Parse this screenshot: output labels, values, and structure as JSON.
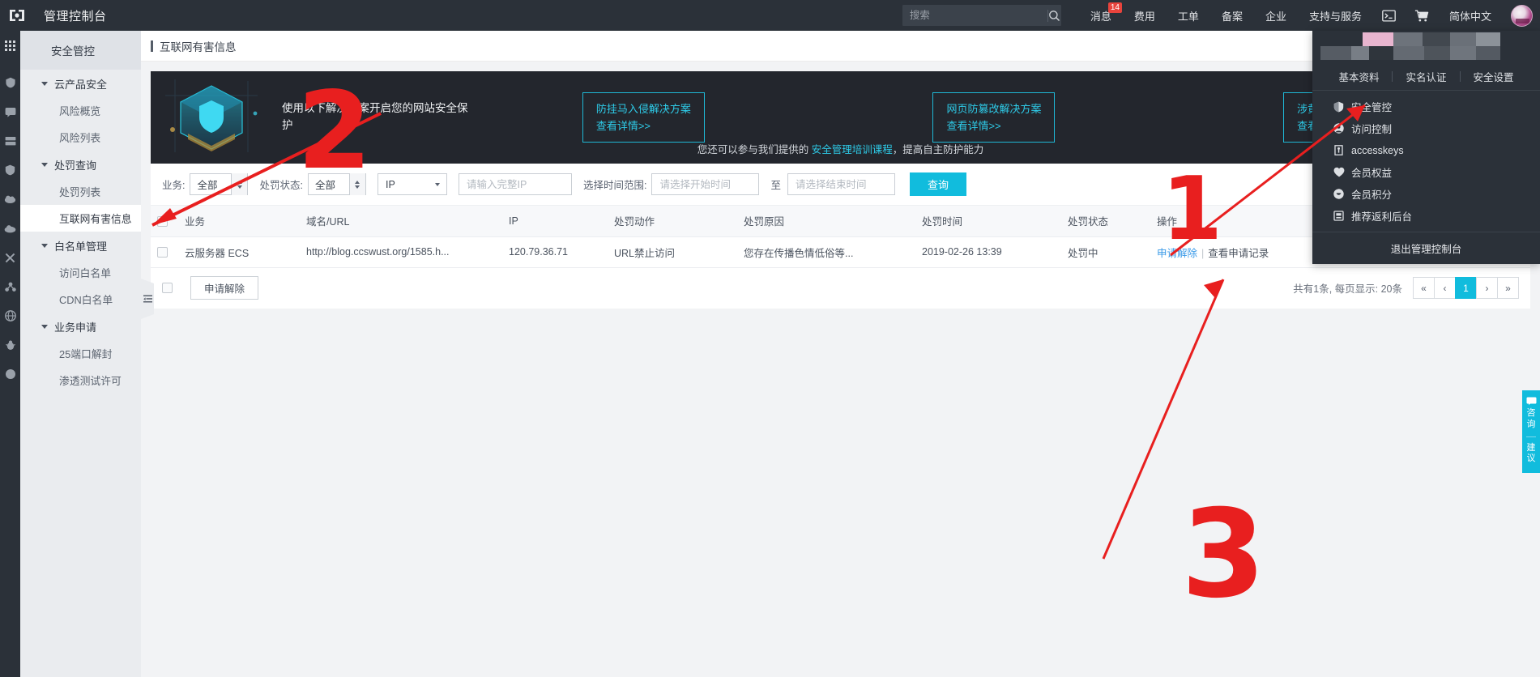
{
  "topbar": {
    "logo_icon": "cloud-bracket-logo-icon",
    "title": "管理控制台",
    "search": {
      "placeholder": "搜索",
      "value": "",
      "icon": "search-icon"
    },
    "nav": [
      {
        "label": "消息",
        "badge": "14"
      },
      {
        "label": "费用",
        "badge": ""
      },
      {
        "label": "工单",
        "badge": ""
      },
      {
        "label": "备案",
        "badge": ""
      },
      {
        "label": "企业",
        "badge": ""
      },
      {
        "label": "支持与服务",
        "badge": ""
      }
    ],
    "terminal_icon": "terminal-icon",
    "cart_icon": "shopping-cart-icon",
    "language": "简体中文",
    "avatar_icon": "user-avatar"
  },
  "rail": {
    "items": [
      "grid-apps-icon",
      "cloud-shield-icon",
      "chat-bubble-icon",
      "server-stack-icon",
      "shield-icon",
      "cloud-network-icon",
      "cloud-storage-icon",
      "scissors-icon",
      "users-group-icon",
      "globe-icon",
      "bug-icon",
      "circle-dot-icon"
    ]
  },
  "sidebar": {
    "header": "安全管控",
    "groups": [
      {
        "label": "云产品安全",
        "items": [
          "风险概览",
          "风险列表"
        ]
      },
      {
        "label": "处罚查询",
        "items": [
          "处罚列表",
          "互联网有害信息"
        ]
      },
      {
        "label": "白名单管理",
        "items": [
          "访问白名单",
          "CDN白名单"
        ]
      },
      {
        "label": "业务申请",
        "items": [
          "25端口解封",
          "渗透测试许可"
        ]
      }
    ],
    "active_item": "互联网有害信息",
    "collapse_icon": "collapse-sidebar-icon"
  },
  "page": {
    "title": "互联网有害信息"
  },
  "banner": {
    "art_icon": "security-cube-shield-illustration",
    "headline": "使用以下解决方案开启您的网站安全保护",
    "solutions": [
      {
        "title": "防挂马入侵解决方案",
        "link": "查看详情>>"
      },
      {
        "title": "网页防篡改解决方案",
        "link": "查看详情>>"
      },
      {
        "title": "涉黄涉政检测解决方案",
        "link": "查看详情>>"
      }
    ],
    "note_prefix": "您还可以参与我们提供的 ",
    "note_link": "安全管理培训课程",
    "note_suffix": "，提高自主防护能力"
  },
  "filters": {
    "business_label": "业务:",
    "business_value": "全部",
    "status_label": "处罚状态:",
    "status_value": "全部",
    "type_value": "IP",
    "ip_placeholder": "请输入完整IP",
    "ip_value": "",
    "date_label": "选择时间范围:",
    "start_placeholder": "请选择开始时间",
    "start_value": "",
    "at_label": "至",
    "end_placeholder": "请选择结束时间",
    "end_value": "",
    "query_button": "查询"
  },
  "table": {
    "columns": [
      "业务",
      "域名/URL",
      "IP",
      "处罚动作",
      "处罚原因",
      "处罚时间",
      "处罚状态",
      "操作"
    ],
    "rows": [
      {
        "business": "云服务器 ECS",
        "url": "http://blog.ccswust.org/1585.h...",
        "ip": "120.79.36.71",
        "action": "URL禁止访问",
        "reason": "您存在传播色情低俗等...",
        "time": "2019-02-26 13:39",
        "status": "处罚中",
        "op_primary": "申请解除",
        "op_separator": "|",
        "op_secondary": "查看申请记录"
      }
    ]
  },
  "footer": {
    "release_button": "申请解除",
    "summary": "共有1条, 每页显示: 20条",
    "pages": [
      "«",
      "‹",
      "1",
      "›",
      "»"
    ],
    "current_page": "1"
  },
  "user_panel": {
    "tabs": [
      "基本资料",
      "实名认证",
      "安全设置"
    ],
    "items": [
      {
        "label": "安全管控",
        "icon": "shield-icon"
      },
      {
        "label": "访问控制",
        "icon": "user-circle-icon"
      },
      {
        "label": "accesskeys",
        "icon": "key-icon"
      },
      {
        "label": "会员权益",
        "icon": "heart-shield-icon"
      },
      {
        "label": "会员积分",
        "icon": "coin-icon"
      },
      {
        "label": "推荐返利后台",
        "icon": "briefcase-icon"
      }
    ],
    "logout": "退出管理控制台"
  },
  "float_widget": {
    "icon": "chat-support-icon",
    "line1": "咨询",
    "line2": "建议"
  },
  "annotations": [
    {
      "id": "1",
      "label": "1"
    },
    {
      "id": "2",
      "label": "2"
    },
    {
      "id": "3",
      "label": "3"
    }
  ],
  "colors": {
    "accent": "#11bcdd",
    "link": "#3a9ae8",
    "topbar_bg": "#2b3139",
    "badge_red": "#e8433c",
    "annotation_red": "#e81f1f",
    "banner_bg": "#23262d"
  }
}
